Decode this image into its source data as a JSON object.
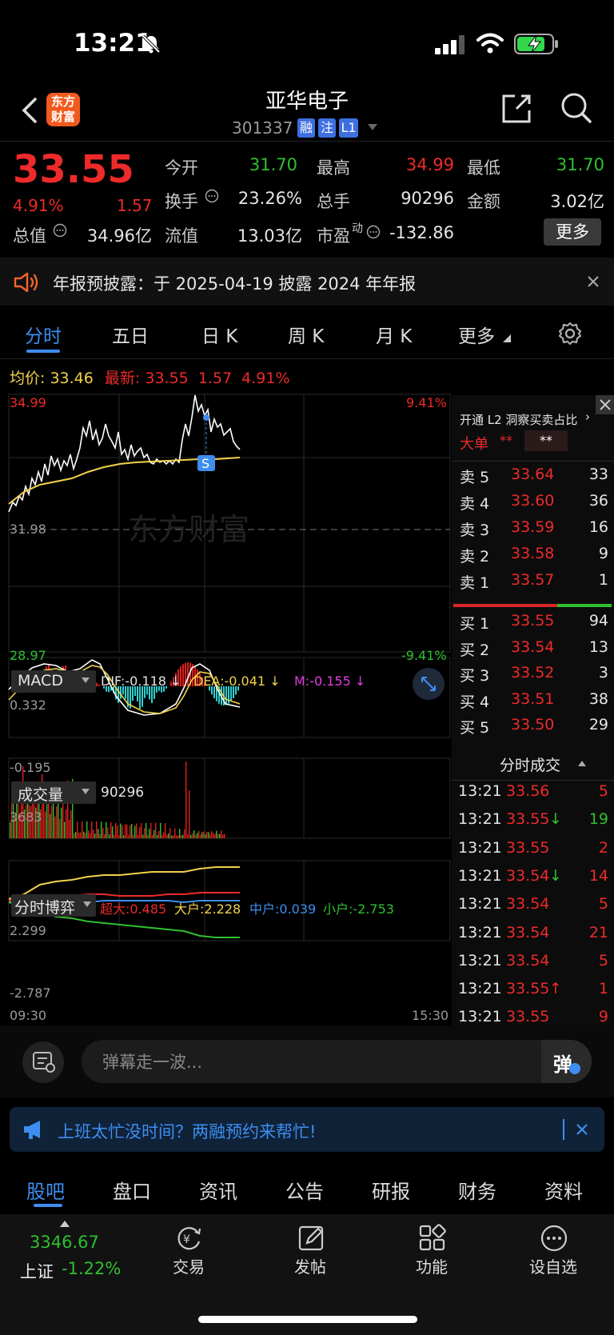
{
  "status": {
    "time": "13:21"
  },
  "header": {
    "logo_line1": "东方",
    "logo_line2": "财富",
    "name": "亚华电子",
    "code": "301337",
    "tags": [
      "融",
      "注",
      "L1"
    ]
  },
  "quote": {
    "price": "33.55",
    "change_pct": "4.91%",
    "change": "1.57",
    "open_label": "今开",
    "open": "31.70",
    "high_label": "最高",
    "high": "34.99",
    "low_label": "最低",
    "low": "31.70",
    "turnover_label": "换手",
    "turnover": "23.26%",
    "volume_label": "总手",
    "volume": "90296",
    "amount_label": "金额",
    "amount": "3.02亿",
    "mktcap_label": "总值",
    "mktcap": "34.96亿",
    "float_label": "流值",
    "float": "13.03亿",
    "pe_label": "市盈",
    "pe_sup": "动",
    "pe": "-132.86",
    "more": "更多"
  },
  "notice": {
    "text": "年报预披露：于 2025-04-19 披露 2024 年年报"
  },
  "tabs": [
    "分时",
    "五日",
    "日 K",
    "周 K",
    "月 K",
    "更多"
  ],
  "chart": {
    "avg_label": "均价:",
    "avg": "33.46",
    "latest_label": "最新:",
    "latest": "33.55",
    "latest_chg": "1.57",
    "latest_pct": "4.91%",
    "y_top": "34.99",
    "y_mid": "31.98",
    "y_bottom": "28.97",
    "pct_top": "9.41%",
    "pct_bottom": "-9.41%",
    "watermark": "东方财富",
    "s_marker": "S",
    "macd_label": "MACD",
    "dif": "DIF:-0.118 ↓",
    "dea": "DEA:-0.041 ↓",
    "m": "M:-0.155 ↓",
    "macd_top": "0.332",
    "macd_bottom": "-0.195",
    "vol_label": "成交量",
    "vol_value": "90296",
    "vol_top": "3683",
    "game_label": "分时博弈",
    "super": "超大:0.485",
    "big": "大户:2.228",
    "mid": "中户:0.039",
    "small": "小户:-2.753",
    "game_top": "2.299",
    "game_bottom": "-2.787",
    "time_start": "09:30",
    "time_end": "15:30"
  },
  "orderbook": {
    "promo": "开通 L2 洞察买卖占比",
    "big_label": "大单",
    "big_val1": "**",
    "big_val2": "**",
    "asks": [
      {
        "label": "卖 5",
        "price": "33.64",
        "vol": "33"
      },
      {
        "label": "卖 4",
        "price": "33.60",
        "vol": "36"
      },
      {
        "label": "卖 3",
        "price": "33.59",
        "vol": "16"
      },
      {
        "label": "卖 2",
        "price": "33.58",
        "vol": "9"
      },
      {
        "label": "卖 1",
        "price": "33.57",
        "vol": "1"
      }
    ],
    "bids": [
      {
        "label": "买 1",
        "price": "33.55",
        "vol": "94"
      },
      {
        "label": "买 2",
        "price": "33.54",
        "vol": "13"
      },
      {
        "label": "买 3",
        "price": "33.52",
        "vol": "3"
      },
      {
        "label": "买 4",
        "price": "33.51",
        "vol": "38"
      },
      {
        "label": "买 5",
        "price": "33.50",
        "vol": "29"
      }
    ],
    "ticks_title": "分时成交",
    "ticks": [
      {
        "time": "13:21",
        "price": "33.56",
        "arrow": "",
        "vol": "5",
        "volc": "red"
      },
      {
        "time": "13:21",
        "price": "33.55",
        "arrow": "↓",
        "vol": "19",
        "volc": "green"
      },
      {
        "time": "13:21",
        "price": "33.55",
        "arrow": "",
        "vol": "2",
        "volc": "red"
      },
      {
        "time": "13:21",
        "price": "33.54",
        "arrow": "↓",
        "vol": "14",
        "volc": "red"
      },
      {
        "time": "13:21",
        "price": "33.54",
        "arrow": "",
        "vol": "5",
        "volc": "red"
      },
      {
        "time": "13:21",
        "price": "33.54",
        "arrow": "",
        "vol": "21",
        "volc": "red"
      },
      {
        "time": "13:21",
        "price": "33.54",
        "arrow": "",
        "vol": "5",
        "volc": "red"
      },
      {
        "time": "13:21",
        "price": "33.55",
        "arrow": "↑",
        "vol": "1",
        "volc": "red"
      },
      {
        "time": "13:21",
        "price": "33.55",
        "arrow": "",
        "vol": "9",
        "volc": "red"
      }
    ]
  },
  "danmu": {
    "placeholder": "弹幕走一波...",
    "send": "弹"
  },
  "ad": {
    "text": "上班太忙没时间？两融预约来帮忙!"
  },
  "bottom_tabs": [
    "股吧",
    "盘口",
    "资讯",
    "公告",
    "研报",
    "财务",
    "资料"
  ],
  "nav": {
    "index_value": "3346.67",
    "index_name": "上证",
    "index_pct": "-1.22%",
    "items": [
      "交易",
      "发帖",
      "功能",
      "设自选"
    ]
  },
  "colors": {
    "up": "#ee2a2a",
    "down": "#2fc02f",
    "accent": "#3d8ef0",
    "avg": "#f2d24a"
  }
}
